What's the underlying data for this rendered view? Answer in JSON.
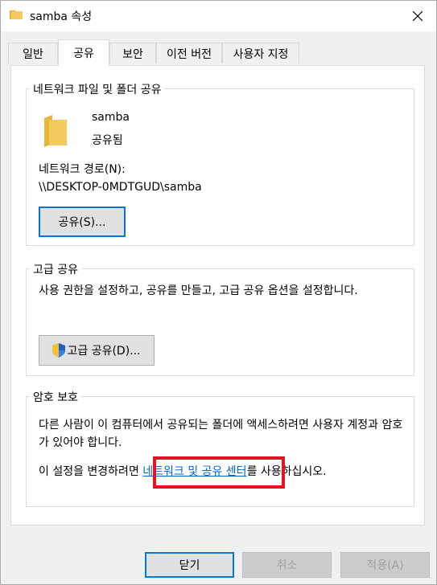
{
  "window": {
    "title": "samba 속성"
  },
  "tabs": [
    {
      "label": "일반"
    },
    {
      "label": "공유"
    },
    {
      "label": "보안"
    },
    {
      "label": "이전 버전"
    },
    {
      "label": "사용자 지정"
    }
  ],
  "network_share": {
    "group_title": "네트워크 파일 및 폴더 공유",
    "folder_name": "samba",
    "status": "공유됨",
    "path_label": "네트워크 경로(N):",
    "path_value": "\\\\DESKTOP-0MDTGUD\\samba",
    "share_button": "공유(S)..."
  },
  "advanced_share": {
    "group_title": "고급 공유",
    "description": "사용 권한을 설정하고, 공유를 만들고, 고급 공유 옵션을 설정합니다.",
    "button": "고급 공유(D)..."
  },
  "password_protection": {
    "group_title": "암호 보호",
    "description": "다른 사람이 이 컴퓨터에서 공유되는 폴더에 액세스하려면 사용자 계정과 암호가 있어야 합니다.",
    "change_prefix": "이 설정을 변경하려면",
    "link_text": "네트워크 및 공유 센터",
    "change_suffix": "를 사용하십시오."
  },
  "footer": {
    "close_button": "닫기",
    "cancel_button": "취소",
    "apply_button": "적용(A)"
  },
  "colors": {
    "accent": "#0078d7",
    "link": "#0066cc",
    "highlight": "#e81123",
    "folder": "#f4c95d"
  }
}
